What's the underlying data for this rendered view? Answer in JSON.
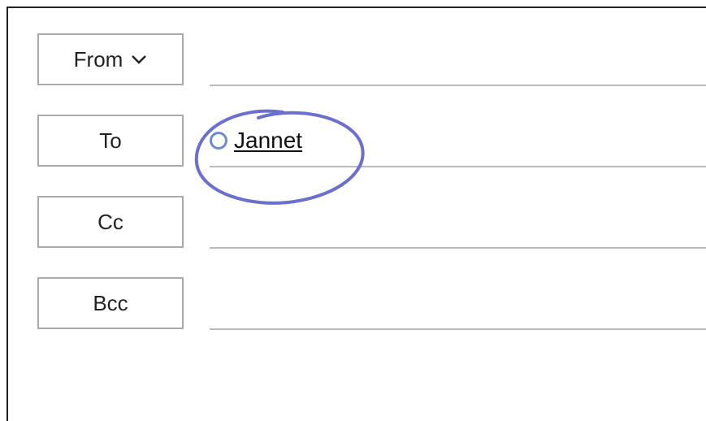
{
  "compose": {
    "from": {
      "label": "From"
    },
    "to": {
      "label": "To",
      "recipient_name": "Jannet "
    },
    "cc": {
      "label": "Cc"
    },
    "bcc": {
      "label": "Bcc"
    }
  },
  "annotation": {
    "stroke": "#6b6fce"
  }
}
